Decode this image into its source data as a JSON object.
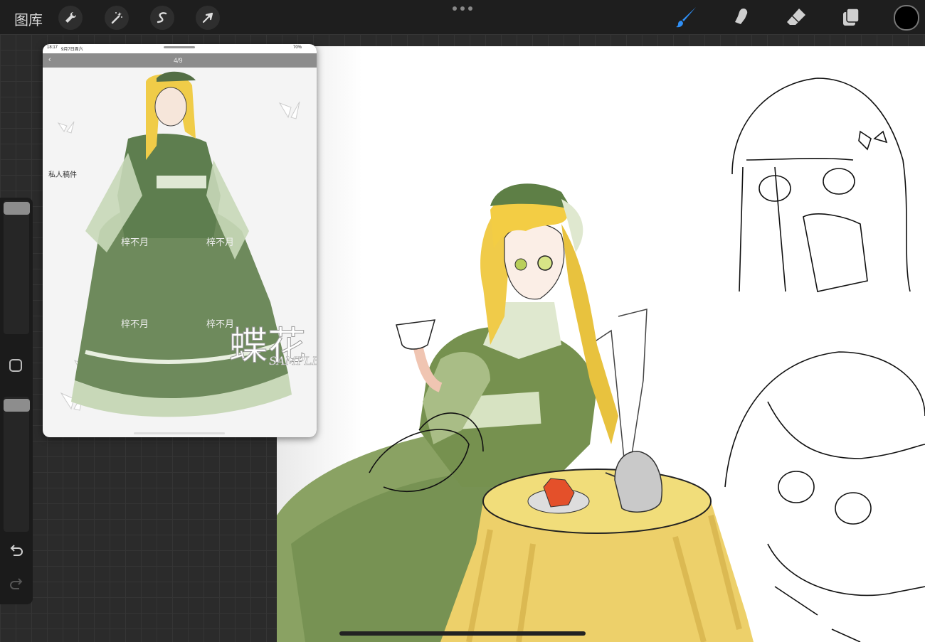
{
  "topbar": {
    "gallery_label": "图库",
    "tools_left": [
      "wrench-icon",
      "magic-wand-icon",
      "selection-icon",
      "transform-arrow-icon"
    ],
    "tools_right": [
      "brush-icon",
      "smudge-icon",
      "eraser-icon",
      "layers-icon"
    ],
    "active_tool": "brush",
    "accent_color": "#2f8ff5",
    "current_color": "#000000"
  },
  "reference": {
    "status_time": "18:17",
    "status_date": "9月7日周六",
    "battery": "70%",
    "page_counter": "4/9",
    "tag": "私人稿件",
    "watermarks": [
      "梓不月",
      "梓不月",
      "梓不月",
      "梓不月"
    ],
    "logo_text": "蝶花",
    "sample_text": "SAMPLE"
  }
}
